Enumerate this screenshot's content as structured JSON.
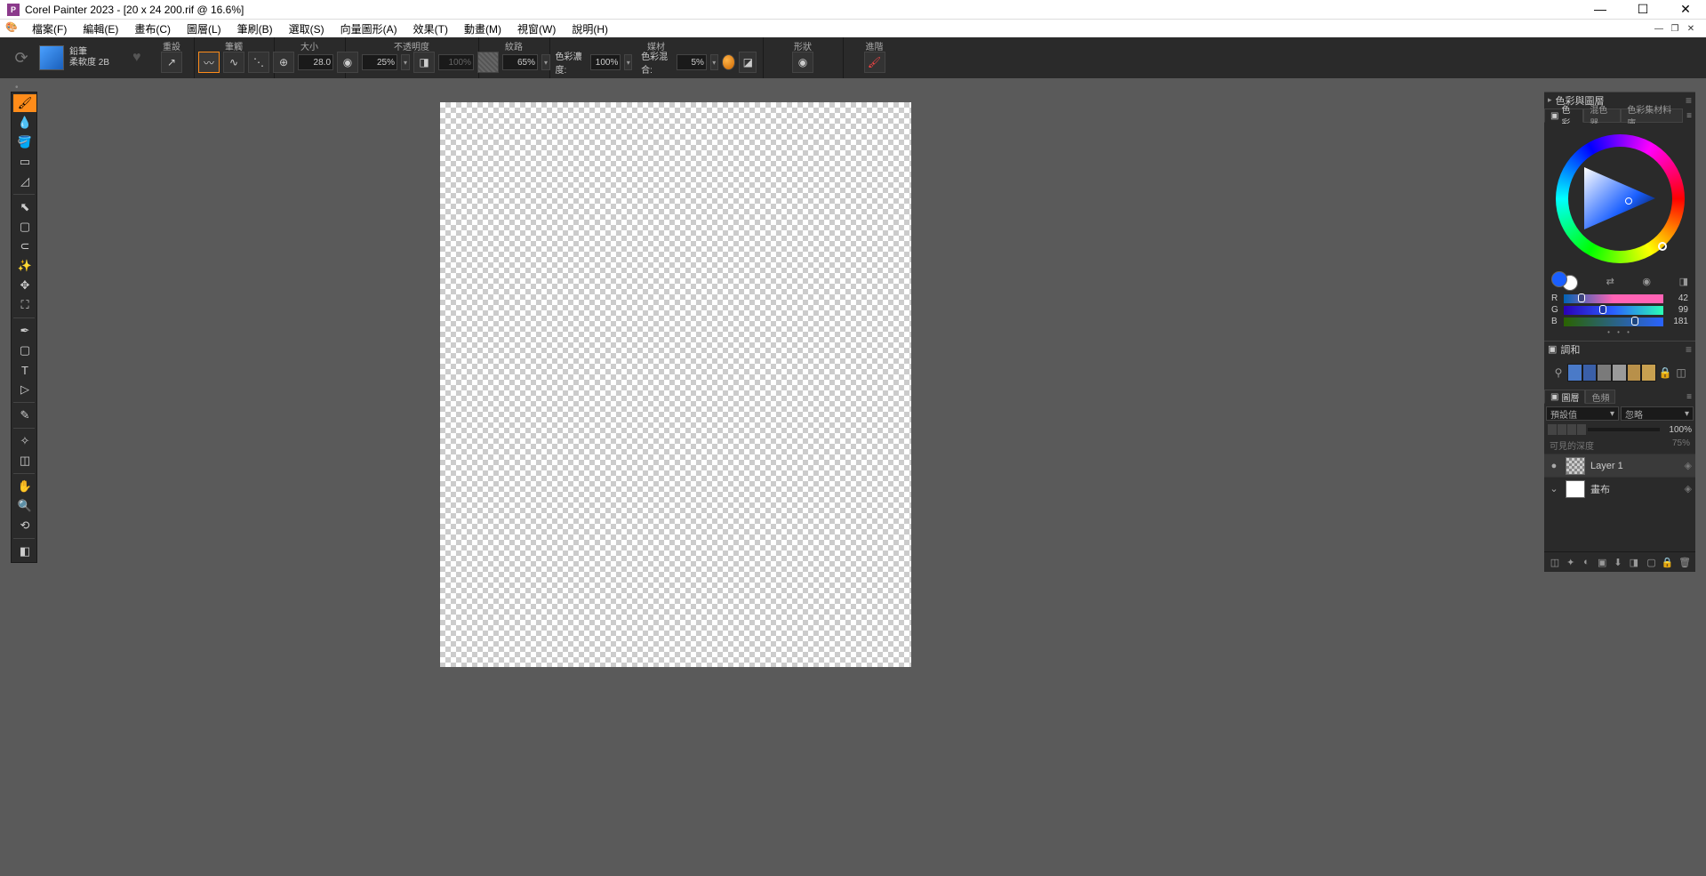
{
  "title": "Corel Painter 2023 - [20 x 24 200.rif @ 16.6%]",
  "app_icon_letter": "P",
  "menu": [
    "檔案(F)",
    "編輯(E)",
    "畫布(C)",
    "圖層(L)",
    "筆刷(B)",
    "選取(S)",
    "向量圖形(A)",
    "效果(T)",
    "動畫(M)",
    "視窗(W)",
    "說明(H)"
  ],
  "brush": {
    "category": "鉛筆",
    "variant": "柔軟度 2B"
  },
  "prop": {
    "reset": "重設",
    "tip": "筆觸",
    "size": "大小",
    "size_val": "28.0",
    "opacity": "不透明度",
    "opacity_val": "25%",
    "opacity2_val": "100%",
    "grain": "紋路",
    "grain_val": "65%",
    "media": "媒材",
    "density_lbl": "色彩濃度:",
    "density_val": "100%",
    "blend_lbl": "色彩混合:",
    "blend_val": "5%",
    "shape": "形狀",
    "advanced": "進階"
  },
  "panels": {
    "group_title": "色彩與圖層",
    "color_tabs": [
      "色彩",
      "混色器",
      "色彩集材料庫"
    ],
    "harmony_title": "調和",
    "layer_tabs": [
      "圖層",
      "色頻"
    ],
    "blend_mode": "預設值",
    "blend_scope": "忽略",
    "layer_opacity": "100%",
    "depth_lbl": "可見的深度",
    "depth_val": "75%",
    "layers": [
      {
        "name": "Layer 1",
        "thumb": "trans",
        "eye": "●"
      },
      {
        "name": "畫布",
        "thumb": "white",
        "eye": "⌄"
      }
    ]
  },
  "rgb": {
    "r": 42,
    "g": 99,
    "b": 181
  },
  "harmony_colors": [
    "#4a7ac8",
    "#3a5fa8",
    "#7a7a7a",
    "#9a9a9a",
    "#b8904a",
    "#c8a050"
  ]
}
